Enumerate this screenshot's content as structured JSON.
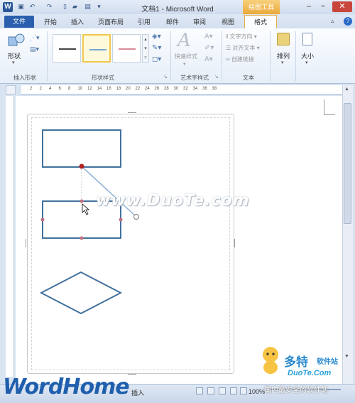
{
  "window": {
    "title": "文档1 - Microsoft Word",
    "context_tab_title": "绘图工具",
    "app_icon_letter": "W"
  },
  "tabs": [
    {
      "label": "文件"
    },
    {
      "label": "开始"
    },
    {
      "label": "插入"
    },
    {
      "label": "页面布局"
    },
    {
      "label": "引用"
    },
    {
      "label": "邮件"
    },
    {
      "label": "审阅"
    },
    {
      "label": "视图"
    },
    {
      "label": "格式"
    }
  ],
  "ribbon": {
    "insert_shapes": {
      "label": "插入形状",
      "shapes_button": "形状"
    },
    "shape_styles": {
      "label": "形状样式"
    },
    "art_styles": {
      "label": "艺术字样式",
      "quick_styles_button": "快速样式"
    },
    "text": {
      "label": "文本",
      "text_direction": "文字方向",
      "align_text": "对齐文本",
      "create_link": "创建链接"
    },
    "arrange": {
      "label": "排列"
    },
    "size": {
      "label": "大小"
    }
  },
  "ruler": {
    "ticks": [
      "2",
      "2",
      "4",
      "6",
      "8",
      "10",
      "12",
      "14",
      "16",
      "18",
      "20",
      "22",
      "24",
      "26",
      "28",
      "30",
      "32",
      "34",
      "36",
      "38"
    ]
  },
  "statusbar": {
    "insert_mode": "插入",
    "zoom": "100%"
  },
  "watermarks": {
    "logo": "WordHome",
    "center": "www.DuoTe.com",
    "brand": "多特",
    "brand_suffix": "软件站",
    "url": "DuoTe.Com",
    "slogan": "国内最安全的软件站"
  },
  "colors": {
    "shape_stroke": "#41719c",
    "handle": "#b22222",
    "file_tab": "#2a5fae",
    "context_tab": "#e9a93a"
  }
}
